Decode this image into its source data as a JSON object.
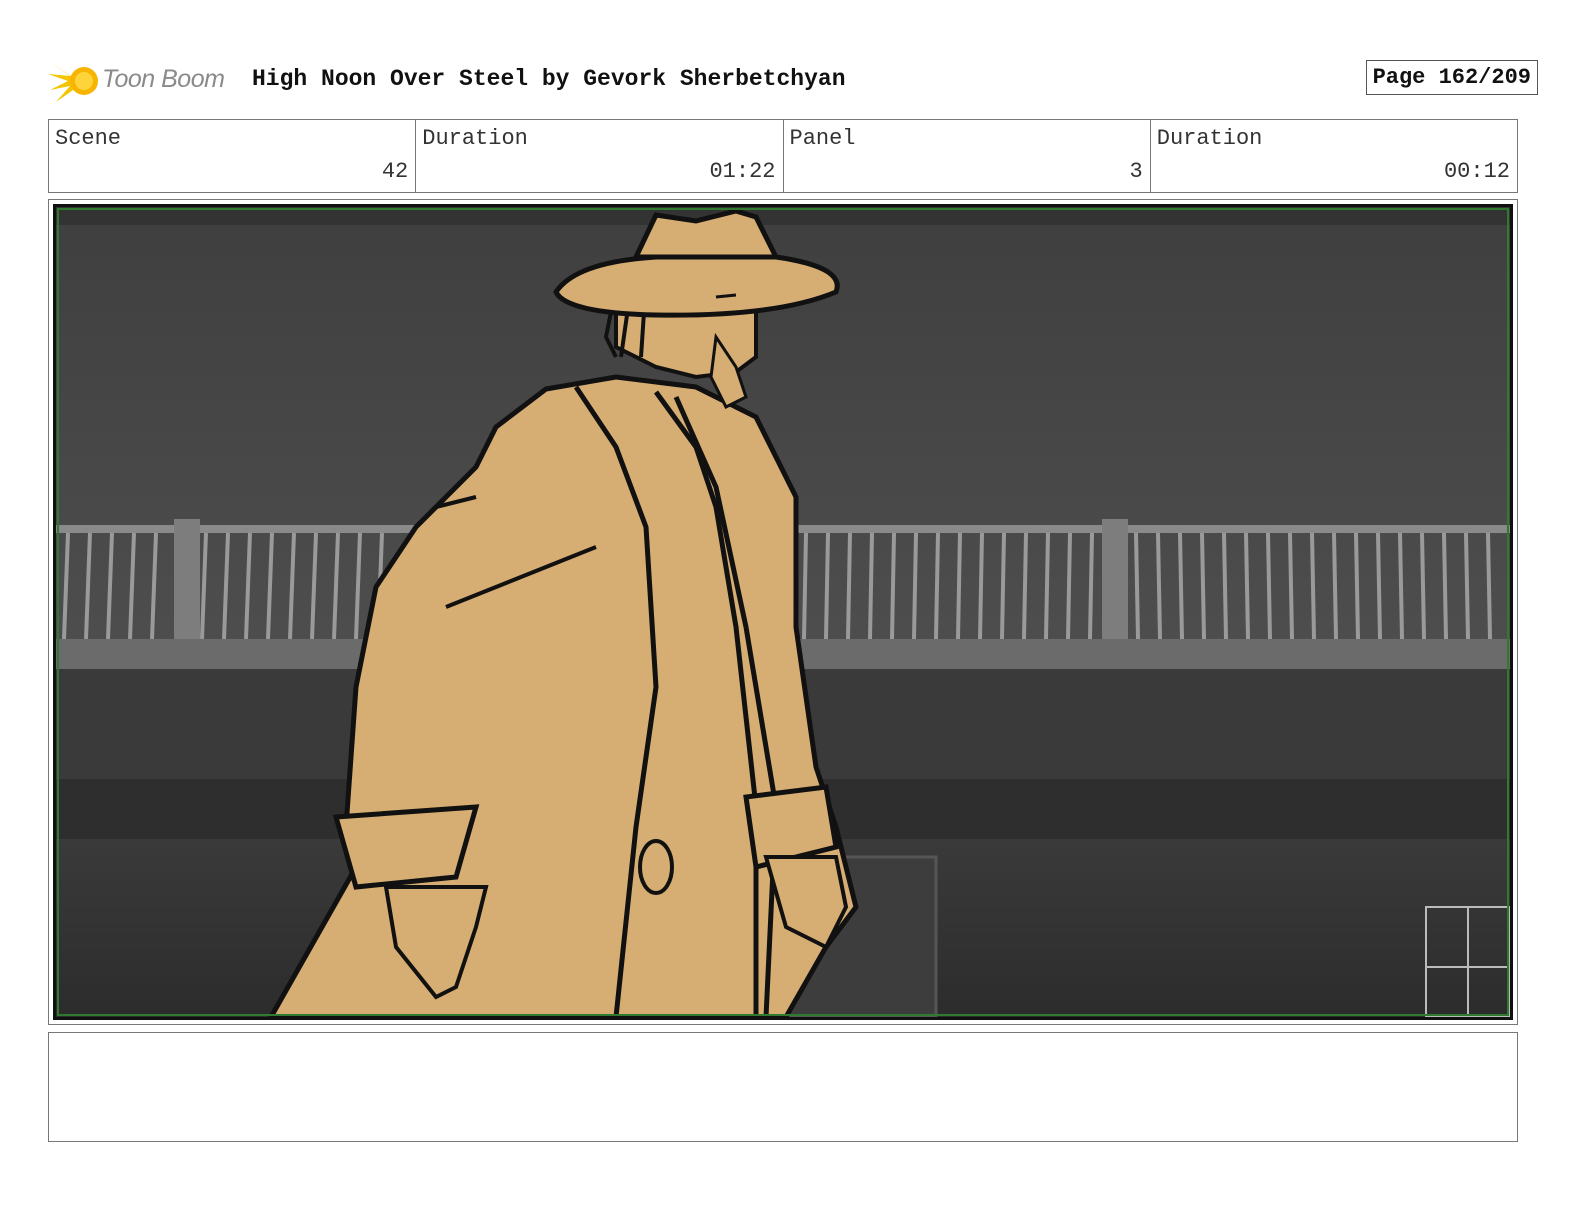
{
  "header": {
    "logo_text": "Toon Boom",
    "title": "High Noon Over Steel by Gevork Sherbetchyan",
    "page": "Page 162/209"
  },
  "info": [
    {
      "label": "Scene",
      "value": "42"
    },
    {
      "label": "Duration",
      "value": "01:22"
    },
    {
      "label": "Panel",
      "value": "3"
    },
    {
      "label": "Duration",
      "value": "00:12"
    }
  ],
  "notes": {
    "text": ""
  },
  "colors": {
    "character_fill": "#d6ad72",
    "outline": "#111111",
    "background_gray": "#4f4f4f",
    "frame_green": "#2f7a2f",
    "logo_yellow": "#f5c400"
  }
}
